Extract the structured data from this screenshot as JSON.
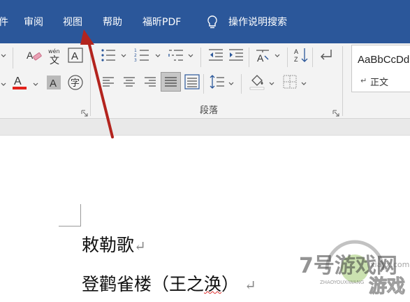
{
  "menu": {
    "items": [
      "件",
      "审阅",
      "视图",
      "帮助",
      "福昕PDF"
    ],
    "tell_me": "操作说明搜索"
  },
  "ribbon": {
    "paragraph_group_label": "段落",
    "style_sample": "AaBbCcDd",
    "style_name": "正文",
    "phonetic_top": "wén",
    "phonetic_char": "文",
    "charborder_char": "A",
    "enclose_char": "字"
  },
  "document": {
    "line1": "敕勒歌",
    "line2_text": "登鹳雀楼（王之",
    "line2_squiggle": "涣",
    "line2_tail": "）",
    "para_mark": "↵"
  },
  "watermark": {
    "brand": "7号游戏网",
    "pinyin": "ZHAOYOUXIWANG",
    "site": "xiayx.com",
    "word": "游戏"
  },
  "colors": {
    "menubar": "#2b579a",
    "ribbon": "#f3f3f3",
    "font_color_bar": "#e3221b",
    "arrow": "#b3241e"
  }
}
